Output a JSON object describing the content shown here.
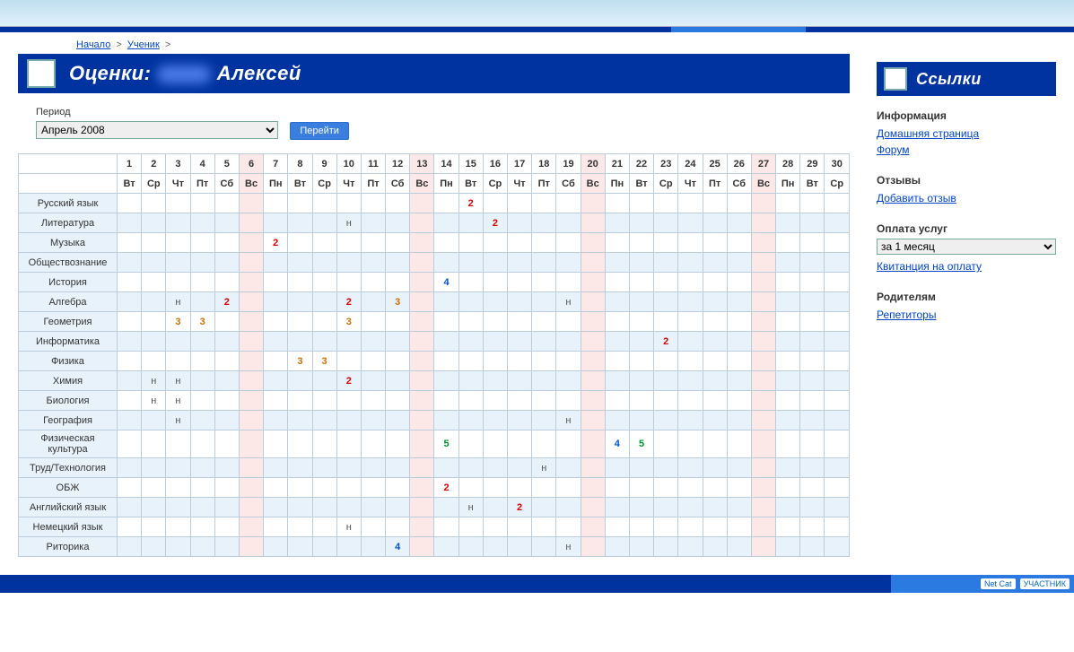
{
  "breadcrumb": {
    "home": "Начало",
    "student": "Ученик"
  },
  "page_title_prefix": "Оценки:",
  "page_title_name": "Алексей",
  "period": {
    "label": "Период",
    "selected": "Апрель 2008",
    "button": "Перейти"
  },
  "days": [
    1,
    2,
    3,
    4,
    5,
    6,
    7,
    8,
    9,
    10,
    11,
    12,
    13,
    14,
    15,
    16,
    17,
    18,
    19,
    20,
    21,
    22,
    23,
    24,
    25,
    26,
    27,
    28,
    29,
    30
  ],
  "weekdays": [
    "Вт",
    "Ср",
    "Чт",
    "Пт",
    "Сб",
    "Вс",
    "Пн",
    "Вт",
    "Ср",
    "Чт",
    "Пт",
    "Сб",
    "Вс",
    "Пн",
    "Вт",
    "Ср",
    "Чт",
    "Пт",
    "Сб",
    "Вс",
    "Пн",
    "Вт",
    "Ср",
    "Чт",
    "Пт",
    "Сб",
    "Вс",
    "Пн",
    "Вт",
    "Ср"
  ],
  "sunday_indices": [
    5,
    12,
    19,
    26
  ],
  "subjects": [
    {
      "name": "Русский язык",
      "marks": {
        "15": {
          "v": "2",
          "t": "grade-2"
        }
      }
    },
    {
      "name": "Литература",
      "marks": {
        "10": {
          "v": "н",
          "t": "absent"
        },
        "16": {
          "v": "2",
          "t": "grade-2"
        }
      }
    },
    {
      "name": "Музыка",
      "marks": {
        "7": {
          "v": "2",
          "t": "grade-2"
        }
      }
    },
    {
      "name": "Обществознание",
      "marks": {}
    },
    {
      "name": "История",
      "marks": {
        "14": {
          "v": "4",
          "t": "grade-4"
        }
      }
    },
    {
      "name": "Алгебра",
      "marks": {
        "3": {
          "v": "н",
          "t": "absent"
        },
        "5": {
          "v": "2",
          "t": "grade-2"
        },
        "10": {
          "v": "2",
          "t": "grade-2"
        },
        "12": {
          "v": "3",
          "t": "grade-3"
        },
        "19": {
          "v": "н",
          "t": "absent"
        }
      }
    },
    {
      "name": "Геометрия",
      "marks": {
        "3": {
          "v": "3",
          "t": "grade-3"
        },
        "4": {
          "v": "3",
          "t": "grade-3"
        },
        "10": {
          "v": "3",
          "t": "grade-3"
        }
      }
    },
    {
      "name": "Информатика",
      "marks": {
        "23": {
          "v": "2",
          "t": "grade-2"
        }
      }
    },
    {
      "name": "Физика",
      "marks": {
        "8": {
          "v": "3",
          "t": "grade-3"
        },
        "9": {
          "v": "3",
          "t": "grade-3"
        }
      }
    },
    {
      "name": "Химия",
      "marks": {
        "2": {
          "v": "н",
          "t": "absent"
        },
        "3": {
          "v": "н",
          "t": "absent"
        },
        "10": {
          "v": "2",
          "t": "grade-2"
        }
      }
    },
    {
      "name": "Биология",
      "marks": {
        "2": {
          "v": "н",
          "t": "absent"
        },
        "3": {
          "v": "н",
          "t": "absent"
        }
      }
    },
    {
      "name": "География",
      "marks": {
        "3": {
          "v": "н",
          "t": "absent"
        },
        "19": {
          "v": "н",
          "t": "absent"
        }
      }
    },
    {
      "name": "Физическая культура",
      "marks": {
        "14": {
          "v": "5",
          "t": "grade-5"
        },
        "21": {
          "v": "4",
          "t": "grade-4"
        },
        "22": {
          "v": "5",
          "t": "grade-5"
        }
      }
    },
    {
      "name": "Труд/Технология",
      "marks": {
        "18": {
          "v": "н",
          "t": "absent"
        }
      }
    },
    {
      "name": "ОБЖ",
      "marks": {
        "14": {
          "v": "2",
          "t": "grade-2"
        }
      }
    },
    {
      "name": "Английский язык",
      "marks": {
        "15": {
          "v": "н",
          "t": "absent"
        },
        "17": {
          "v": "2",
          "t": "grade-2"
        }
      }
    },
    {
      "name": "Немецкий язык",
      "marks": {
        "10": {
          "v": "н",
          "t": "absent"
        }
      }
    },
    {
      "name": "Риторика",
      "marks": {
        "12": {
          "v": "4",
          "t": "grade-4"
        },
        "19": {
          "v": "н",
          "t": "absent"
        }
      }
    }
  ],
  "sidebar": {
    "title": "Ссылки",
    "info": {
      "heading": "Информация",
      "links": [
        "Домашняя страница",
        "Форум"
      ]
    },
    "reviews": {
      "heading": "Отзывы",
      "links": [
        "Добавить отзыв"
      ]
    },
    "payment": {
      "heading": "Оплата услуг",
      "select": "за 1 месяц",
      "links": [
        "Квитанция на оплату"
      ]
    },
    "parents": {
      "heading": "Родителям",
      "links": [
        "Репетиторы"
      ]
    }
  },
  "footer": {
    "badge1": "Net Cat",
    "badge2": "УЧАСТНИК"
  }
}
